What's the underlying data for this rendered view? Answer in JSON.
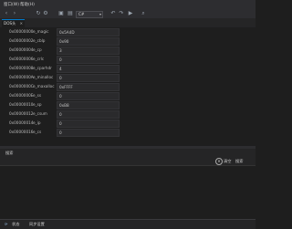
{
  "menu": {
    "items": [
      "窗口(W)",
      "帮助(H)"
    ]
  },
  "toolbar": {
    "combo_value": "C#"
  },
  "tab": {
    "label": "DOS头",
    "close": "✕"
  },
  "rows": [
    {
      "addr": "0x00000000",
      "field": "e_magic",
      "value": "0x5A4D"
    },
    {
      "addr": "0x00000002",
      "field": "e_cblp",
      "value": "0x90"
    },
    {
      "addr": "0x00000004",
      "field": "e_cp",
      "value": "3"
    },
    {
      "addr": "0x00000006",
      "field": "e_crlc",
      "value": "0"
    },
    {
      "addr": "0x00000008",
      "field": "e_cparhdr",
      "value": "4"
    },
    {
      "addr": "0x0000000A",
      "field": "e_minalloc",
      "value": "0"
    },
    {
      "addr": "0x0000000C",
      "field": "e_maxalloc",
      "value": "0xFFFF"
    },
    {
      "addr": "0x0000000E",
      "field": "e_ss",
      "value": "0"
    },
    {
      "addr": "0x00000010",
      "field": "e_sp",
      "value": "0xB8"
    },
    {
      "addr": "0x00000012",
      "field": "e_csum",
      "value": "0"
    },
    {
      "addr": "0x00000014",
      "field": "e_ip",
      "value": "0"
    },
    {
      "addr": "0x00000016",
      "field": "e_cs",
      "value": "0"
    }
  ],
  "panel": {
    "title": "搜索",
    "clear_label": "清空",
    "search_label": "搜索"
  },
  "status": {
    "icon": "⟳",
    "text1": "状态",
    "text2": "同步设置"
  }
}
